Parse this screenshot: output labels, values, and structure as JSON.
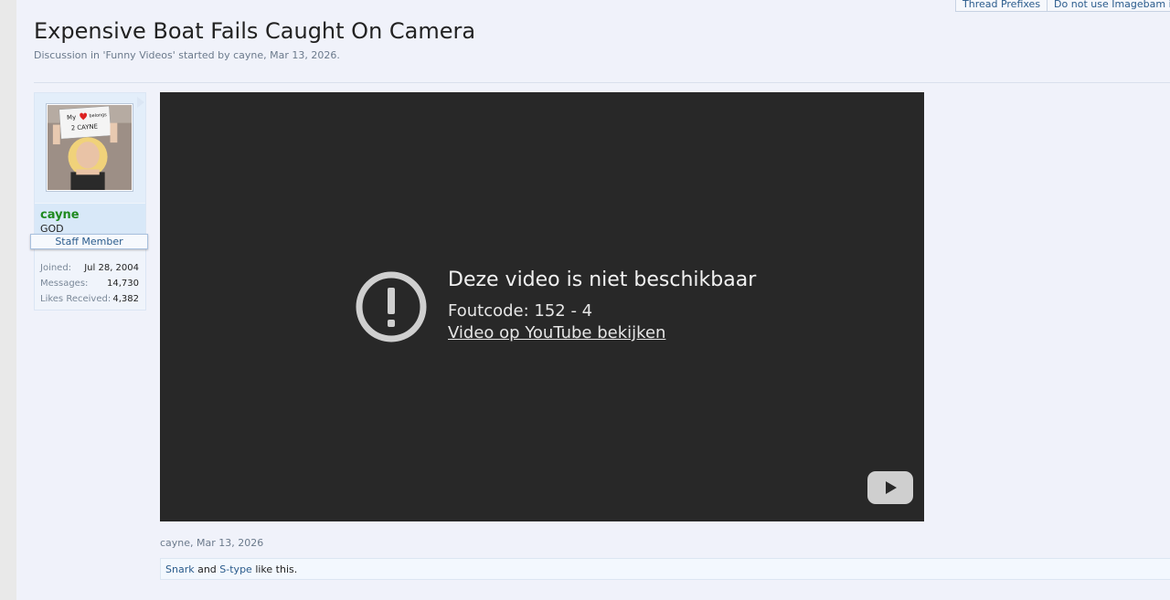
{
  "top_tabs": [
    "Thread Prefixes",
    "Do not use Imagebam in GIF"
  ],
  "thread": {
    "title": "Expensive Boat Fails Caught On Camera",
    "meta": "Discussion in 'Funny Videos' started by cayne, Mar 13, 2026."
  },
  "user": {
    "name": "cayne",
    "rank": "GOD",
    "badge": "Staff Member",
    "avatar_sign_text": "My ♥ belongs 2 CAYNE",
    "stats": [
      {
        "label": "Joined:",
        "value": "Jul 28, 2004"
      },
      {
        "label": "Messages:",
        "value": "14,730"
      },
      {
        "label": "Likes Received:",
        "value": "4,382"
      }
    ]
  },
  "video": {
    "error_title": "Deze video is niet beschikbaar",
    "error_code": "Foutcode: 152 - 4",
    "error_link": "Video op YouTube bekijken",
    "icons": [
      "alert-icon",
      "youtube-play-icon"
    ]
  },
  "post": {
    "meta": "cayne, Mar 13, 2026",
    "likes": {
      "user1": "Snark",
      "conj": " and ",
      "user2": "S-type",
      "suffix": " like this."
    }
  },
  "colors": {
    "background": "#f0f2fa",
    "video_bg": "#282828",
    "username": "#1f8a1f",
    "link": "#2a5b8c"
  }
}
